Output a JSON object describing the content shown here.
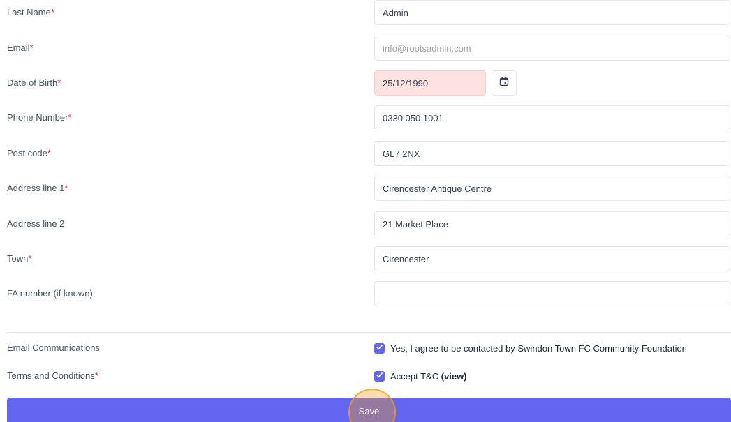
{
  "form": {
    "last_name": {
      "label": "Last Name",
      "required": "*",
      "value": "Admin"
    },
    "email": {
      "label": "Email",
      "required": "*",
      "value": "",
      "placeholder": "info@rootsadmin.com"
    },
    "dob": {
      "label": "Date of Birth",
      "required": "*",
      "value": "25/12/1990",
      "picker_icon": "calendar-icon"
    },
    "phone": {
      "label": "Phone Number",
      "required": "*",
      "value": "0330 050 1001"
    },
    "postcode": {
      "label": "Post code",
      "required": "*",
      "value": "GL7 2NX"
    },
    "address1": {
      "label": "Address line 1",
      "required": "*",
      "value": "Cirencester Antique Centre"
    },
    "address2": {
      "label": "Address line 2",
      "value": "21 Market Place"
    },
    "town": {
      "label": "Town",
      "required": "*",
      "value": "Cirencester"
    },
    "fa_number": {
      "label": "FA number (if known)",
      "value": ""
    }
  },
  "consent": {
    "email_comms": {
      "label": "Email Communications",
      "checked": true,
      "text": "Yes, I agree to be contacted by Swindon Town FC Community Foundation"
    },
    "terms": {
      "label": "Terms and Conditions",
      "required": "*",
      "checked": true,
      "text": "Accept T&C",
      "link": "(view)"
    }
  },
  "actions": {
    "save_label": "Save"
  },
  "colors": {
    "accent": "#6366f1",
    "required": "#e11d48",
    "error_bg": "#fde2e2",
    "cursor_highlight": "#f59e0b"
  }
}
